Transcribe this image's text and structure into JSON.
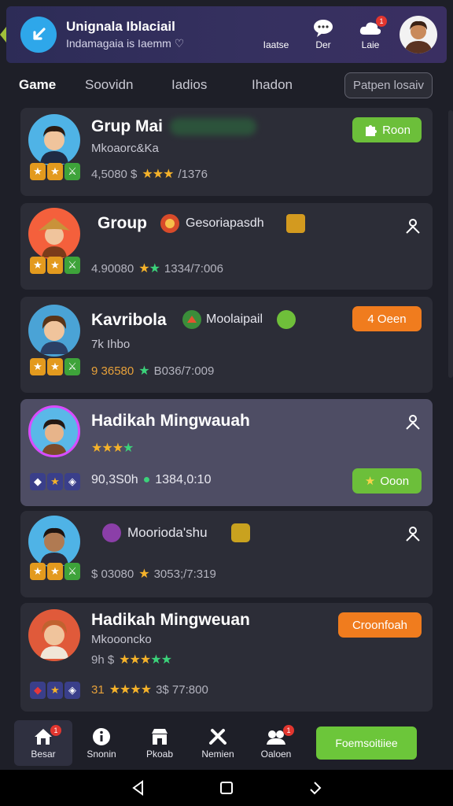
{
  "header": {
    "title": "Unignala Iblaciail",
    "subtitle": "Indamagaia is Iaemm ♡",
    "actions": [
      {
        "label": "Iaatse",
        "icon": "bell-icon"
      },
      {
        "label": "Der",
        "icon": "chat-icon",
        "badge": ""
      },
      {
        "label": "Laie",
        "icon": "cloud-icon",
        "badge": "1"
      }
    ]
  },
  "tabs": [
    {
      "label": "Game",
      "active": true
    },
    {
      "label": "Soovidn"
    },
    {
      "label": "Iadios"
    },
    {
      "label": "Ihadon"
    }
  ],
  "tab_button": "Patpen losaiv",
  "cards": [
    {
      "name": "Grup Mai",
      "sub": "Mkoaorc&Ka",
      "stats": "4,5080 $",
      "stats2": "/1376",
      "button": "Roon",
      "button_icon": "puzzle-icon",
      "button_color": "#6cbf3a"
    },
    {
      "name": "Group",
      "tag": "Gesoriapasdh",
      "stats": "4.90080",
      "stats2": "1334/7:006"
    },
    {
      "name": "Kavribola",
      "tag": "Moolaipail",
      "sub": "7k Ihbo",
      "stats": "9 36580",
      "stats2": "B036/7:009",
      "button": "4 Oeen",
      "button_icon": "star-icon",
      "button_color": "#f07c1e"
    },
    {
      "name": "Hadikah Mingwauah",
      "stats": "90,3S0h",
      "stats2": "1384,0:10",
      "button": "Ooon",
      "button_icon": "star-icon",
      "button_color": "#6cbf3a"
    },
    {
      "name": "Moorioda'shu",
      "stats": "$ 03080",
      "stats2": "3053;/7:319"
    },
    {
      "name": "Hadikah Mingweuan",
      "sub": "Mkoooncko",
      "sub2": "9h $",
      "stats": "31",
      "stats2": "3$ 77:800",
      "button": "Croonfoah",
      "button_color": "#f07c1e"
    }
  ],
  "bottom_nav": [
    {
      "label": "Besar",
      "icon": "home-icon",
      "badge": "1",
      "active": true
    },
    {
      "label": "Snonin",
      "icon": "info-icon"
    },
    {
      "label": "Pkoab",
      "icon": "shop-icon"
    },
    {
      "label": "Nemien",
      "icon": "tools-icon"
    },
    {
      "label": "Oaloen",
      "icon": "group-icon",
      "badge": "1"
    }
  ],
  "nav_cta": "Foemsoitiiee"
}
